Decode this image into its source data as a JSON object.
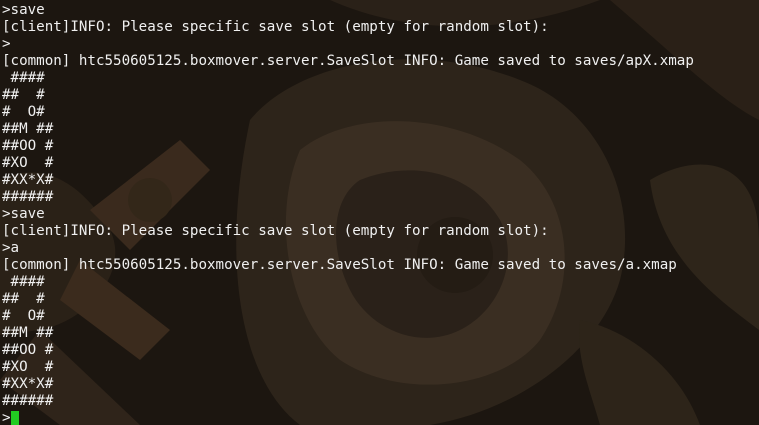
{
  "terminal": {
    "lines": [
      ">save",
      "[client]INFO: Please specific save slot (empty for random slot):",
      ">",
      "[common] htc550605125.boxmover.server.SaveSlot INFO: Game saved to saves/apX.xmap",
      " ####",
      "##  #",
      "#  O#",
      "##M ##",
      "##OO #",
      "#XO  #",
      "#XX*X#",
      "######",
      ">save",
      "[client]INFO: Please specific save slot (empty for random slot):",
      ">a",
      "[common] htc550605125.boxmover.server.SaveSlot INFO: Game saved to saves/a.xmap",
      " ####",
      "##  #",
      "#  O#",
      "##M ##",
      "##OO #",
      "#XO  #",
      "#XX*X#",
      "######"
    ],
    "prompt": ">",
    "cursor_color": "#22cc22",
    "text_color": "#f0f0f0"
  }
}
